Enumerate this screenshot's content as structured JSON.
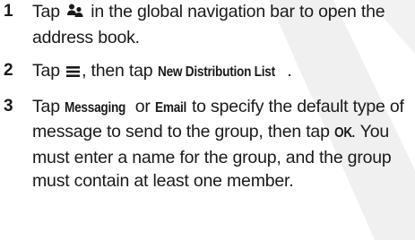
{
  "steps": [
    {
      "number": "1",
      "text_before": "Tap",
      "icon": "contacts-icon",
      "text_after": "in the global navigation bar to open the address book."
    },
    {
      "number": "2",
      "text_before": "Tap",
      "icon": "menu-icon",
      "text_mid": ", then tap",
      "keyword": "New Distribution List",
      "text_after": "."
    },
    {
      "number": "3",
      "text_before": "Tap",
      "keyword_1": "Messaging",
      "text_or": "or",
      "keyword_2": "Email",
      "text_mid": "to specify the default type of message to send to the group, then tap",
      "keyword_3": "OK",
      "text_after": ". You must enter a name for the group, and the group must contain at least one member."
    }
  ],
  "colors": {
    "text": "#1a1a1a",
    "watermark": "#eeeeee"
  }
}
